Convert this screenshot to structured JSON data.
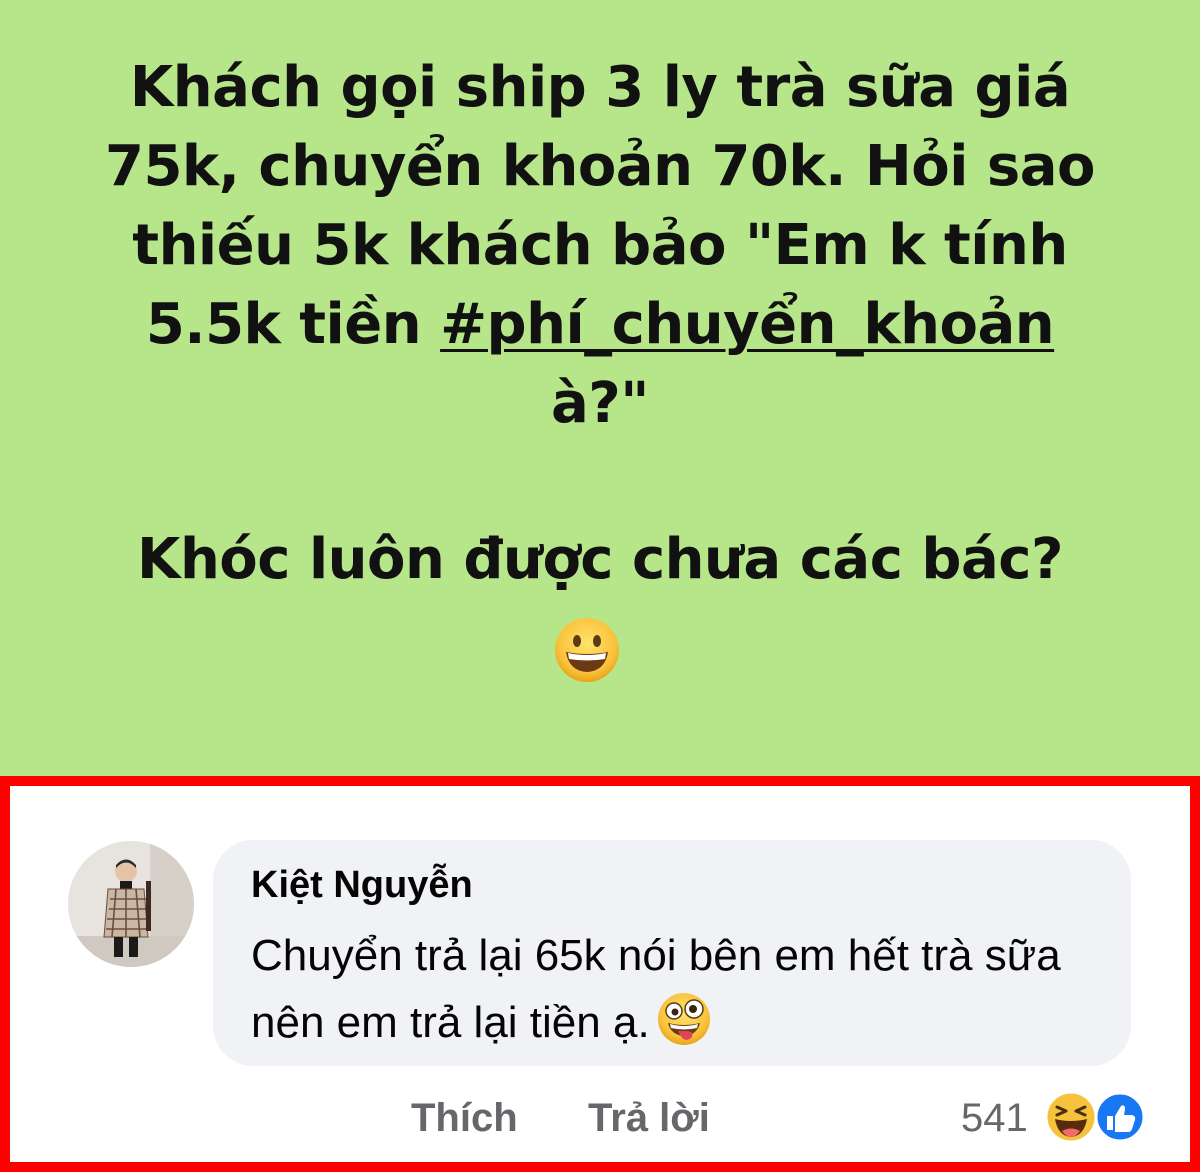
{
  "post": {
    "line_1": "Khách gọi ship 3 ly trà sữa giá",
    "line_2": "75k, chuyển khoản 70k. Hỏi sao",
    "line_3": "thiếu 5k khách bảo \"Em k tính",
    "line_4_prefix": "5.5k tiền ",
    "hashtag": "#phí_chuyển_khoản",
    "line_5": "à?\"",
    "line_6": "Khóc luôn được chưa các bác?",
    "emoji": "grinning-face-icon",
    "background_color": "#b7e68a"
  },
  "comment": {
    "author": "Kiệt Nguyễn",
    "text": "Chuyển trả lại 65k nói bên em hết trà sữa nên em trả lại tiền ạ.",
    "emoji": "zany-face-icon",
    "actions": {
      "like_label": "Thích",
      "reply_label": "Trả lời"
    },
    "reactions": {
      "count": "541",
      "icons": [
        "laughing-reaction-icon",
        "like-reaction-icon"
      ]
    },
    "highlight_color": "#ff0000"
  }
}
